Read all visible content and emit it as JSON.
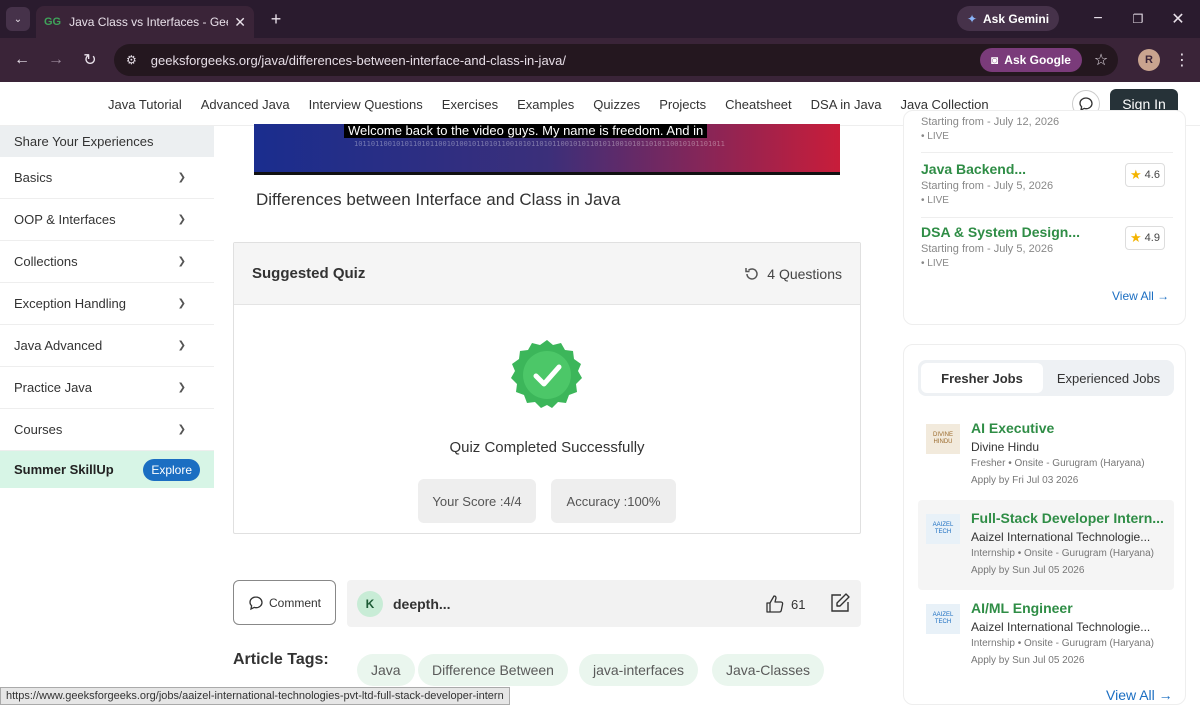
{
  "browser": {
    "tab_title": "Java Class vs Interfaces - GeeksforGeeks",
    "tab_close": "✕",
    "new_tab": "+",
    "ask_gemini": "Ask Gemini",
    "url": "geeksforgeeks.org/java/differences-between-interface-and-class-in-java/",
    "ask_google": "Ask Google",
    "profile_initial": "R",
    "status_url": "https://www.geeksforgeeks.org/jobs/aaizel-international-technologies-pvt-ltd-full-stack-developer-intern"
  },
  "nav": {
    "links": [
      "Java Tutorial",
      "Advanced Java",
      "Interview Questions",
      "Exercises",
      "Examples",
      "Quizzes",
      "Projects",
      "Cheatsheet",
      "DSA in Java",
      "Java Collection"
    ],
    "sign_in": "Sign In"
  },
  "sidebar": {
    "header": "Share Your Experiences",
    "items": [
      "Basics",
      "OOP & Interfaces",
      "Collections",
      "Exception Handling",
      "Java Advanced",
      "Practice Java",
      "Courses"
    ],
    "promo_label": "Summer SkillUp",
    "promo_button": "Explore"
  },
  "video": {
    "caption": "Welcome back to the video guys. My name is freedom. And in",
    "title": "Differences between Interface and Class in Java"
  },
  "quiz": {
    "title": "Suggested Quiz",
    "questions": "4 Questions",
    "status": "Quiz Completed Successfully",
    "score": "Your Score :4/4",
    "accuracy": "Accuracy :100%"
  },
  "comment": {
    "button": "Comment",
    "avatar_initial": "K",
    "author": "deepth...",
    "likes": "61"
  },
  "tags": {
    "label": "Article Tags:",
    "items": [
      "Java",
      "Difference Between",
      "java-interfaces",
      "Java-Classes"
    ]
  },
  "courses": {
    "partial": "Starting from - July 12, 2026",
    "partial_live": "• LIVE",
    "items": [
      {
        "name": "Java Backend...",
        "start": "Starting from - July 5, 2026",
        "live": "• LIVE",
        "rating": "4.6"
      },
      {
        "name": "DSA & System Design...",
        "start": "Starting from - July 5, 2026",
        "live": "• LIVE",
        "rating": "4.9"
      }
    ],
    "view_all": "View All →"
  },
  "jobs": {
    "tabs": [
      "Fresher Jobs",
      "Experienced Jobs"
    ],
    "items": [
      {
        "title": "AI Executive",
        "company": "Divine Hindu",
        "meta": "Fresher • Onsite - Gurugram (Haryana)",
        "apply": "Apply by Fri Jul 03 2026",
        "logo": "DIVINE HINDU"
      },
      {
        "title": "Full-Stack Developer Intern...",
        "company": "Aaizel International Technologie...",
        "meta": "Internship • Onsite - Gurugram (Haryana)",
        "apply": "Apply by Sun Jul 05 2026",
        "logo": "AAIZEL TECH"
      },
      {
        "title": "AI/ML Engineer",
        "company": "Aaizel International Technologie...",
        "meta": "Internship • Onsite - Gurugram (Haryana)",
        "apply": "Apply by Sun Jul 05 2026",
        "logo": "AAIZEL TECH"
      }
    ],
    "view_all": "View All →"
  },
  "colors": {
    "brand_green": "#2f8d46",
    "link_blue": "#1b6ec2",
    "badge_green": "#3cb65a"
  }
}
